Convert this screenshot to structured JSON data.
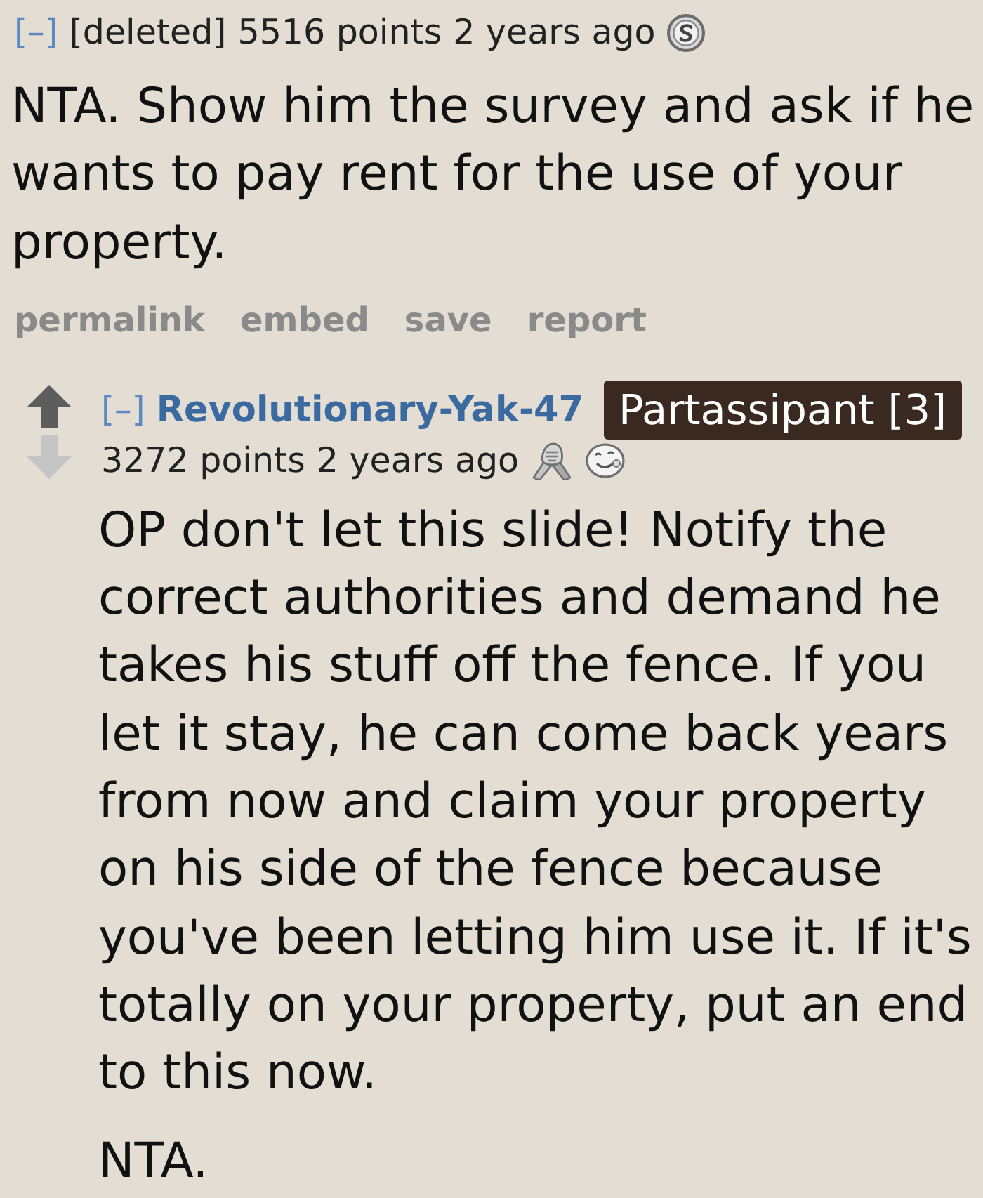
{
  "comments": [
    {
      "collapse": "[–]",
      "author": {
        "name": "[deleted]",
        "kind": "deleted"
      },
      "points": "5516 points",
      "time": "2 years ago",
      "awards": [
        {
          "kind": "coin"
        }
      ],
      "paragraphs": [
        "NTA. Show him the survey and ask if he wants to pay rent for the use of your property."
      ],
      "actions": [
        "permalink",
        "embed",
        "save",
        "report"
      ]
    },
    {
      "collapse": "[–]",
      "author": {
        "name": "Revolutionary-Yak-47",
        "kind": "user"
      },
      "flair": "Partassipant [3]",
      "votes": true,
      "points": "3272 points",
      "time": "2 years ago",
      "awards": [
        {
          "kind": "hands"
        },
        {
          "kind": "face"
        }
      ],
      "paragraphs": [
        "OP don't let this slide! Notify the correct authorities and demand he takes his stuff off the fence. If you let it stay, he can come back years from now and claim your property on his side of the fence because you've been letting him use it. If it's totally on your property, put an end to this now.",
        "NTA."
      ]
    }
  ]
}
